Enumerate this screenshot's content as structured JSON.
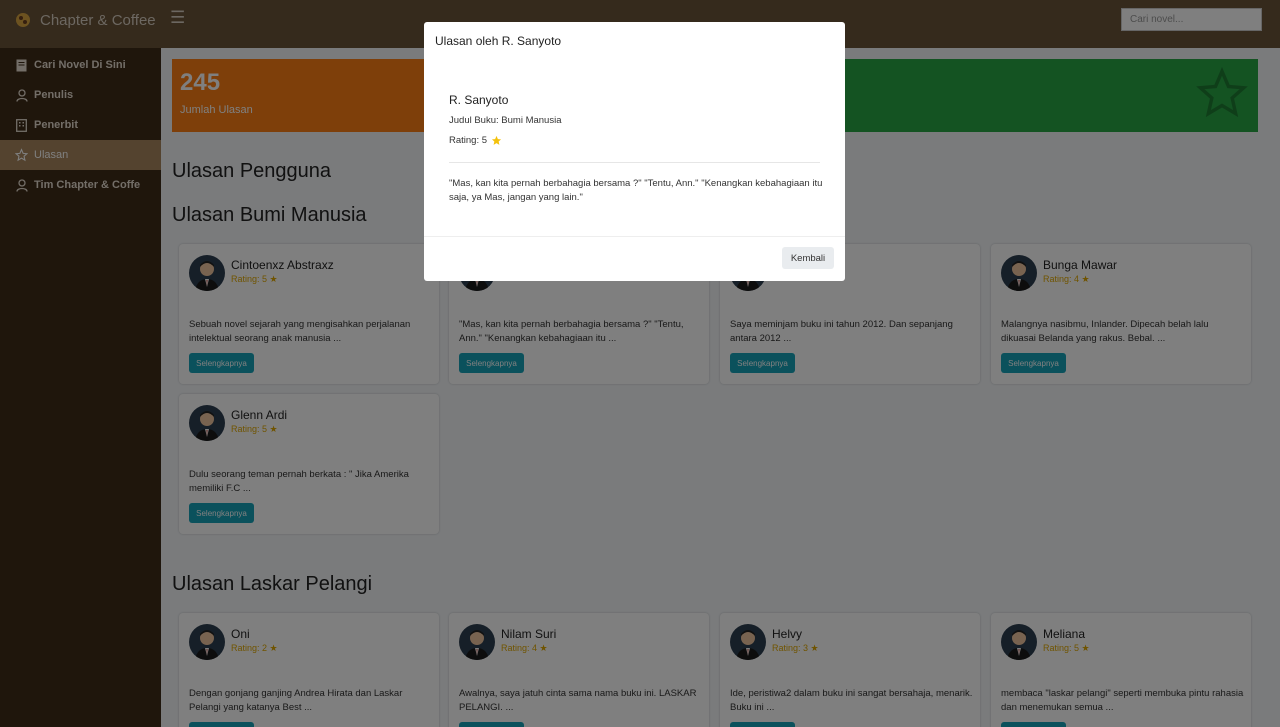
{
  "app": {
    "name": "Chapter & Coffee",
    "search_placeholder": "Cari novel..."
  },
  "sidebar": {
    "items": [
      {
        "label": "Cari Novel Di Sini",
        "icon": "book-icon"
      },
      {
        "label": "Penulis",
        "icon": "user-icon"
      },
      {
        "label": "Penerbit",
        "icon": "building-icon"
      },
      {
        "label": "Ulasan",
        "icon": "star-icon",
        "active": true
      },
      {
        "label": "Tim Chapter & Coffe",
        "icon": "user-icon"
      }
    ]
  },
  "stats": [
    {
      "value": "245",
      "label": "Jumlah Ulasan",
      "color": "#fd7e14"
    },
    {
      "value": "",
      "label": "",
      "color": "#28a745",
      "icon": "star-outline-icon"
    }
  ],
  "headings": {
    "main": "Ulasan Pengguna",
    "section1": "Ulasan Bumi Manusia",
    "section2": "Ulasan Laskar Pelangi"
  },
  "cards_bumi": [
    {
      "name": "Cintoenxz Abstraxz",
      "rating": "Rating: 5",
      "text": "Sebuah novel sejarah yang mengisahkan perjalanan intelektual seorang anak manusia ...",
      "button": "Selengkapnya"
    },
    {
      "name": "",
      "rating": "",
      "text": "\"Mas, kan kita pernah berbahagia bersama ?\" \"Tentu, Ann.\" \"Kenangkan kebahagiaan itu ...",
      "button": "Selengkapnya"
    },
    {
      "name": "",
      "rating": "",
      "text": "Saya meminjam buku ini tahun 2012. Dan sepanjang antara 2012 ...",
      "button": "Selengkapnya"
    },
    {
      "name": "Bunga Mawar",
      "rating": "Rating: 4",
      "text": "Malangnya nasibmu, Inlander. Dipecah belah lalu dikuasai Belanda yang rakus. Bebal. ...",
      "button": "Selengkapnya"
    },
    {
      "name": "Glenn Ardi",
      "rating": "Rating: 5",
      "text": "Dulu seorang teman pernah berkata : \" Jika Amerika memiliki F.C ...",
      "button": "Selengkapnya"
    }
  ],
  "cards_laskar": [
    {
      "name": "Oni",
      "rating": "Rating: 2",
      "text": "Dengan gonjang ganjing Andrea Hirata dan Laskar Pelangi yang katanya Best ..."
    },
    {
      "name": "Nilam Suri",
      "rating": "Rating: 4",
      "text": "Awalnya, saya jatuh cinta sama nama buku ini. LASKAR PELANGI. ..."
    },
    {
      "name": "Helvy",
      "rating": "Rating: 3",
      "text": "Ide, peristiwa2 dalam buku ini sangat bersahaja, menarik. Buku ini ..."
    },
    {
      "name": "Meliana",
      "rating": "Rating: 5",
      "text": "membaca \"laskar pelangi\" seperti membuka pintu rahasia dan menemukan semua ..."
    }
  ],
  "modal": {
    "title": "Ulasan oleh R. Sanyoto",
    "name": "R. Sanyoto",
    "book": "Judul Buku: Bumi Manusia",
    "rating": "Rating: 5",
    "quote": "\"Mas, kan kita pernah berbahagia bersama ?\" \"Tentu, Ann.\" \"Kenangkan kebahagiaan itu saja, ya Mas, jangan yang lain.\"",
    "close_button": "Kembali"
  }
}
